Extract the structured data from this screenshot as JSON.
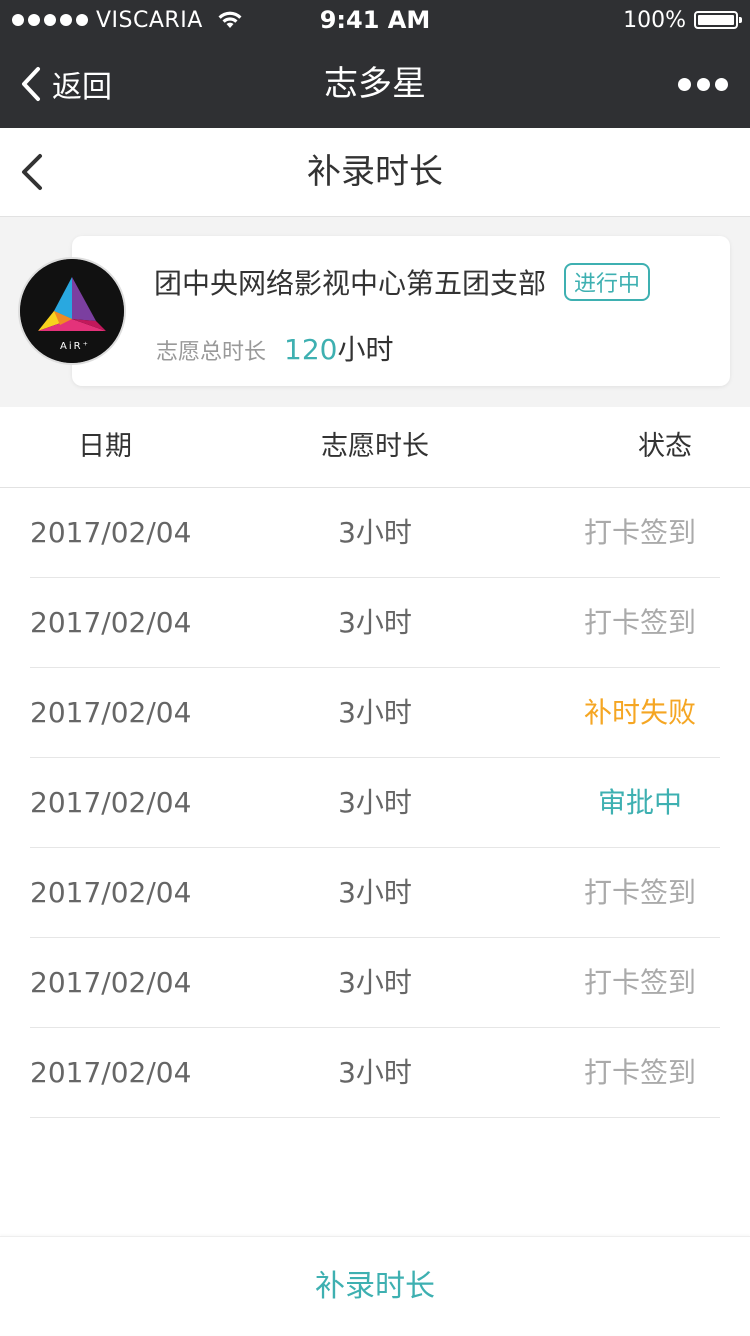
{
  "status_bar": {
    "carrier": "VISCARIA",
    "time": "9:41 AM",
    "battery": "100%",
    "signal_bars": 5
  },
  "nav": {
    "back_label": "返回",
    "title": "志多星"
  },
  "page": {
    "title": "补录时长"
  },
  "summary": {
    "org_name": "团中央网络影视中心第五团支部",
    "status": "进行中",
    "total_label": "志愿总时长",
    "total_value": "120",
    "total_unit": "小时",
    "logo_text": "AiR⁺"
  },
  "table": {
    "headers": {
      "date": "日期",
      "hours": "志愿时长",
      "status": "状态"
    },
    "rows": [
      {
        "date": "2017/02/04",
        "hours": "3小时",
        "status": "打卡签到",
        "status_color": "#aaaaaa"
      },
      {
        "date": "2017/02/04",
        "hours": "3小时",
        "status": "打卡签到",
        "status_color": "#aaaaaa"
      },
      {
        "date": "2017/02/04",
        "hours": "3小时",
        "status": "补时失败",
        "status_color": "#f5a623"
      },
      {
        "date": "2017/02/04",
        "hours": "3小时",
        "status": "审批中",
        "status_color": "#3eb0b1"
      },
      {
        "date": "2017/02/04",
        "hours": "3小时",
        "status": "打卡签到",
        "status_color": "#aaaaaa"
      },
      {
        "date": "2017/02/04",
        "hours": "3小时",
        "status": "打卡签到",
        "status_color": "#aaaaaa"
      },
      {
        "date": "2017/02/04",
        "hours": "3小时",
        "status": "打卡签到",
        "status_color": "#aaaaaa"
      }
    ]
  },
  "bottom": {
    "button_label": "补录时长"
  },
  "colors": {
    "accent": "#3eb0b1",
    "warning": "#f5a623",
    "muted": "#aaaaaa",
    "nav_bg": "#2f3033"
  },
  "icons": {
    "back": "chevron-left-icon",
    "more": "more-dots-icon",
    "wifi": "wifi-icon",
    "battery": "battery-icon"
  }
}
